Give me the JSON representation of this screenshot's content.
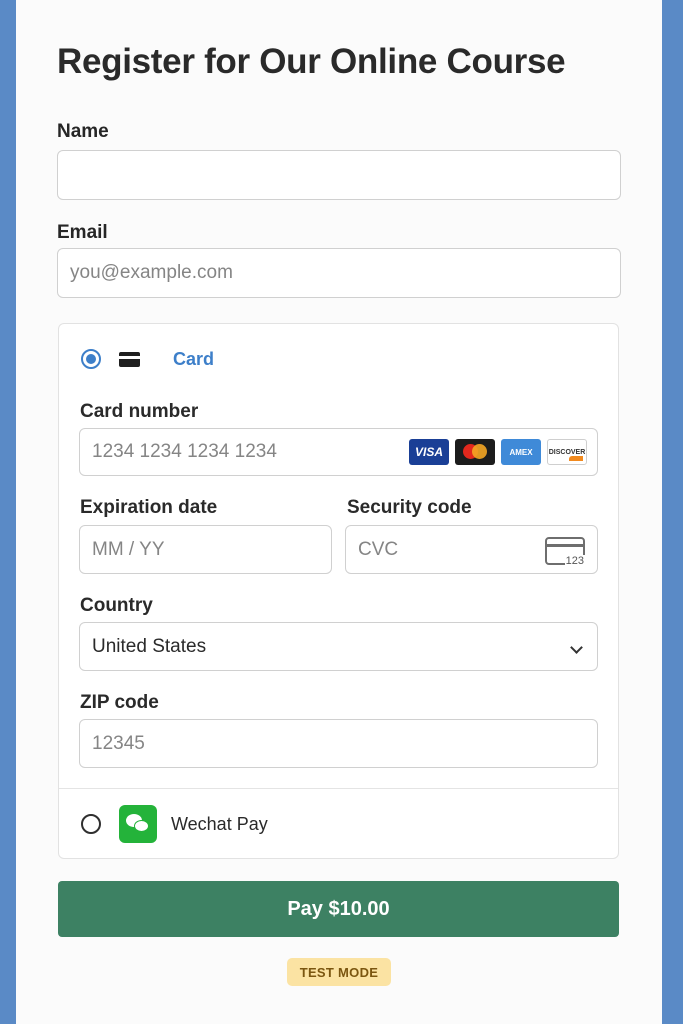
{
  "form": {
    "title": "Register for Our Online Course",
    "name_label": "Name",
    "name_value": "",
    "email_label": "Email",
    "email_placeholder": "you@example.com"
  },
  "payment": {
    "card_tab_label": "Card",
    "card_number_label": "Card number",
    "card_number_placeholder": "1234 1234 1234 1234",
    "brands": [
      "VISA",
      "Mastercard",
      "AMEX",
      "DISCOVER"
    ],
    "expiration_label": "Expiration date",
    "expiration_placeholder": "MM / YY",
    "security_label": "Security code",
    "security_placeholder": "CVC",
    "cvc_icon_text": "123",
    "country_label": "Country",
    "country_value": "United States",
    "zip_label": "ZIP code",
    "zip_placeholder": "12345",
    "wechat_label": "Wechat Pay",
    "selected_method": "Card"
  },
  "actions": {
    "pay_label": "Pay $10.00",
    "test_mode_label": "TEST MODE"
  },
  "colors": {
    "accent": "#3d7fc9",
    "pay_button": "#3d8163",
    "page_background": "#5a8ac6",
    "test_badge": "#fbe3a3"
  }
}
